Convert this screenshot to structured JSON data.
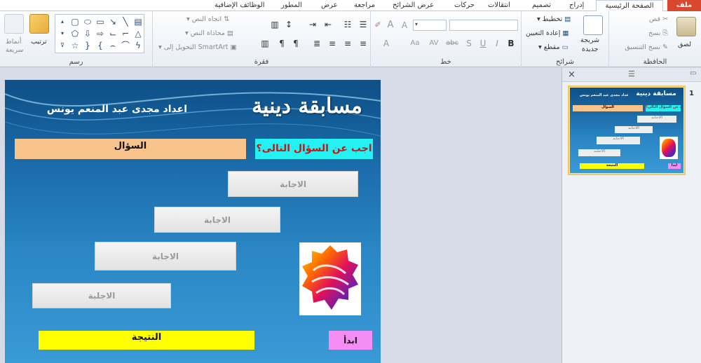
{
  "tabs": {
    "file": "ملف",
    "home": "الصفحة الرئيسية",
    "insert": "إدراج",
    "design": "تصميم",
    "transitions": "انتقالات",
    "animations": "حركات",
    "slideshow": "عرض الشرائح",
    "review": "مراجعة",
    "view": "عرض",
    "developer": "المطور",
    "addins": "الوظائف الإضافية"
  },
  "ribbon": {
    "clipboard": {
      "label": "الحافظة",
      "paste": "لصق",
      "cut": "قص",
      "copy": "نسخ",
      "format_painter": "نسخ التنسيق"
    },
    "slides": {
      "label": "شرائح",
      "new_slide_line1": "شريحة",
      "new_slide_line2": "جديدة",
      "layout": "تخطيط",
      "reset": "إعادة التعيين",
      "section": "مقطع"
    },
    "font": {
      "label": "خط",
      "bold": "B",
      "italic": "I",
      "underline": "U",
      "shadow": "S",
      "strike": "abc",
      "spacing": "AV",
      "case": "Aa",
      "color": "A",
      "grow": "A",
      "shrink": "A"
    },
    "paragraph": {
      "label": "فقرة",
      "text_direction": "اتجاه النص",
      "align_text": "محاذاة النص",
      "smartart": "التحويل إلى SmartArt"
    },
    "drawing": {
      "label": "رسم",
      "arrange": "ترتيب",
      "quick_styles_line1": "أنماط",
      "quick_styles_line2": "سريعة"
    }
  },
  "slide": {
    "title": "مسابقة دينية",
    "author": "اعداد مجدى عبد المنعم يونس",
    "question": "السؤال",
    "prompt": "اجب عن السؤال التالى؟",
    "answers": [
      "الاجابة",
      "الاجابة",
      "الاجابة",
      "الاجلبة"
    ],
    "result": "النتيجة",
    "start": "ابدأ"
  },
  "thumbnail": {
    "number": "1"
  },
  "panel": {
    "close": "×"
  }
}
